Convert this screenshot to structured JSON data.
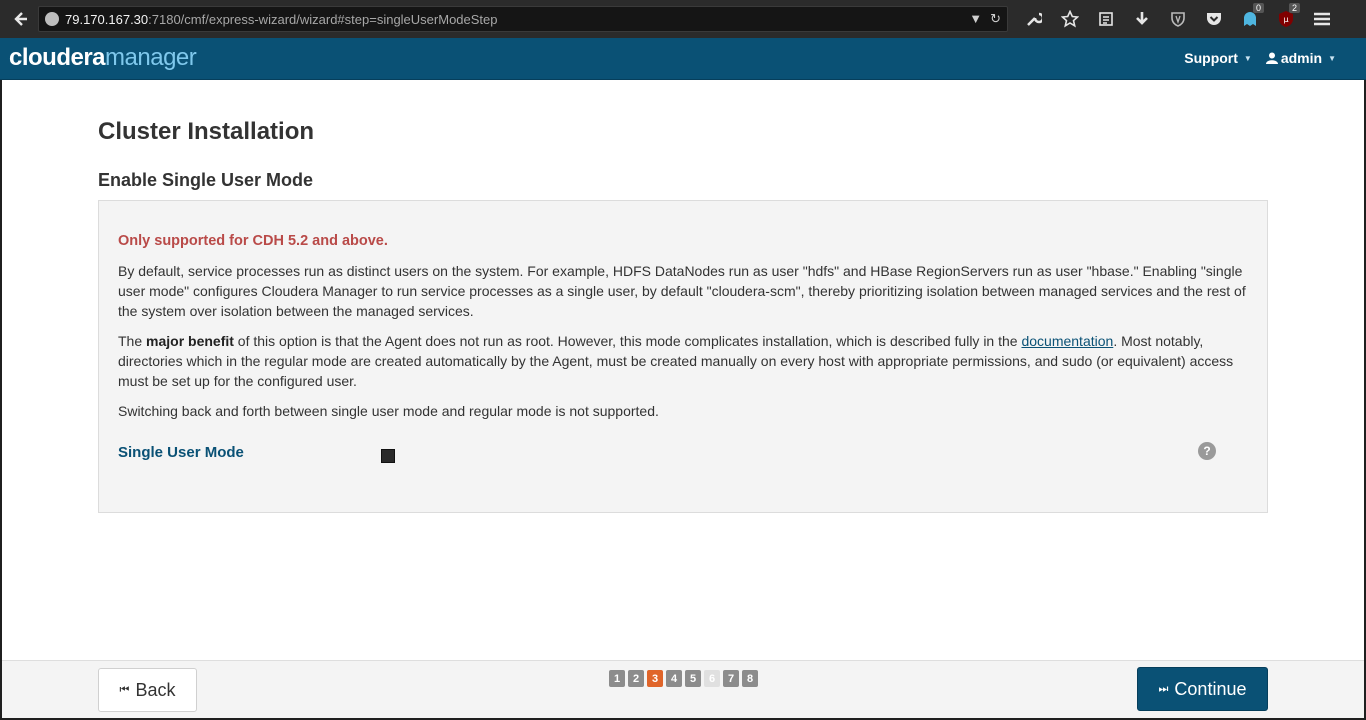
{
  "browser": {
    "url_host": "79.170.167.30",
    "url_path": ":7180/cmf/express-wizard/wizard#step=singleUserModeStep",
    "badges": {
      "ghostery": "0",
      "ublock": "2"
    }
  },
  "header": {
    "logo_primary": "cloudera",
    "logo_secondary": "manager",
    "support_label": "Support",
    "user_label": "admin"
  },
  "page": {
    "title": "Cluster Installation",
    "section_title": "Enable Single User Mode",
    "warning": "Only supported for CDH 5.2 and above.",
    "para1": "By default, service processes run as distinct users on the system. For example, HDFS DataNodes run as user \"hdfs\" and HBase RegionServers run as user \"hbase.\" Enabling \"single user mode\" configures Cloudera Manager to run service processes as a single user, by default \"cloudera-scm\", thereby prioritizing isolation between managed services and the rest of the system over isolation between the managed services.",
    "para2_prefix": "The ",
    "para2_bold": "major benefit",
    "para2_mid": " of this option is that the Agent does not run as root. However, this mode complicates installation, which is described fully in the ",
    "para2_link": "documentation",
    "para2_suffix": ". Most notably, directories which in the regular mode are created automatically by the Agent, must be created manually on every host with appropriate permissions, and sudo (or equivalent) access must be set up for the configured user.",
    "para3": "Switching back and forth between single user mode and regular mode is not supported.",
    "field_label": "Single User Mode",
    "help_glyph": "?"
  },
  "footer": {
    "back_label": "Back",
    "continue_label": "Continue",
    "steps": [
      "1",
      "2",
      "3",
      "4",
      "5",
      "6",
      "7",
      "8"
    ],
    "current_step": "3"
  }
}
